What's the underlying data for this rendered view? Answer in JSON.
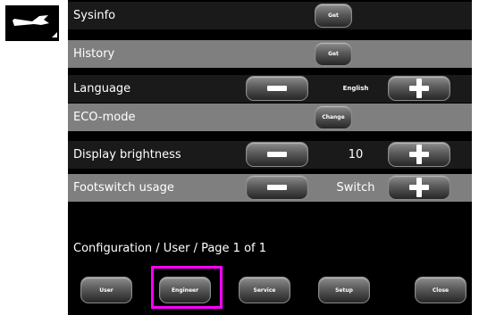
{
  "tool_icon": "wrench-icon",
  "rows": [
    {
      "label": "Sysinfo",
      "button": "Get"
    },
    {
      "label": "History",
      "button": "Get"
    },
    {
      "label": "Language",
      "value": "English"
    },
    {
      "label": "ECO-mode",
      "button": "Change"
    },
    {
      "label": "Display brightness",
      "value": "10"
    },
    {
      "label": "Footswitch usage",
      "value": "Switch"
    }
  ],
  "path": "Configuration / User / Page 1 of 1",
  "bottom_buttons": [
    "User",
    "Engineer",
    "Service",
    "Setup",
    "Close"
  ],
  "colors": {
    "highlight": "#ff00ff",
    "row_light": "#7f7f7f",
    "row_dark": "#1a1a1a"
  }
}
